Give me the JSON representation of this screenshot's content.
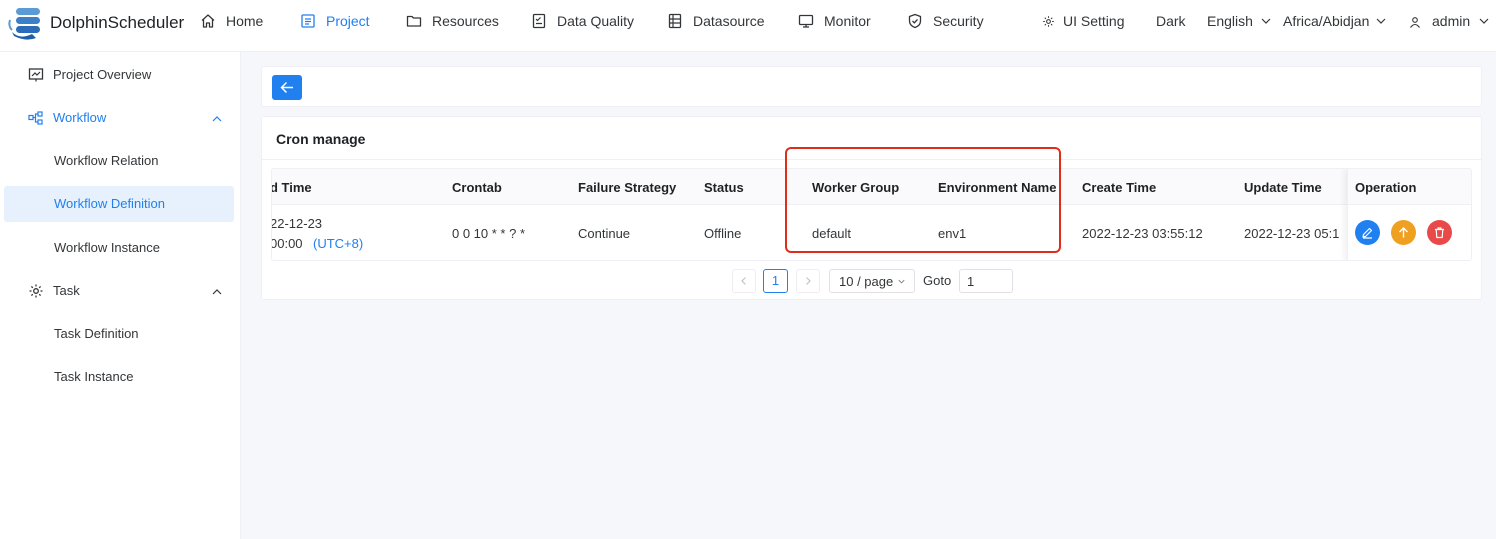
{
  "brand": {
    "name": "DolphinScheduler",
    "accent": "#2080f0"
  },
  "nav": {
    "home": "Home",
    "project": "Project",
    "resources": "Resources",
    "data_quality": "Data Quality",
    "datasource": "Datasource",
    "monitor": "Monitor",
    "security": "Security"
  },
  "header_right": {
    "ui_setting": "UI Setting",
    "theme": "Dark",
    "language": "English",
    "timezone": "Africa/Abidjan",
    "user": "admin"
  },
  "sidebar": {
    "project_overview": "Project Overview",
    "workflow": "Workflow",
    "workflow_relation": "Workflow Relation",
    "workflow_definition": "Workflow Definition",
    "workflow_instance": "Workflow Instance",
    "task": "Task",
    "task_definition": "Task Definition",
    "task_instance": "Task Instance"
  },
  "main": {
    "card_title": "Cron manage",
    "columns": {
      "end_time": "d Time",
      "crontab": "Crontab",
      "failure_strategy": "Failure Strategy",
      "status": "Status",
      "worker_group": "Worker Group",
      "environment_name": "Environment Name",
      "create_time": "Create Time",
      "update_time": "Update Time",
      "operation": "Operation"
    },
    "row": {
      "end_time_date": "22-12-23",
      "end_time_clock": "00:00",
      "end_time_tz": "(UTC+8)",
      "crontab": "0 0 10 * * ? *",
      "failure_strategy": "Continue",
      "status": "Offline",
      "worker_group": "default",
      "environment_name": "env1",
      "create_time": "2022-12-23 03:55:12",
      "update_time": "2022-12-23 05:1"
    },
    "pagination": {
      "current_page": "1",
      "page_size": "10 / page",
      "goto_label": "Goto",
      "goto_value": "1"
    }
  },
  "colors": {
    "edit": "#2080f0",
    "online": "#f0a020",
    "delete": "#d03050",
    "highlight": "#e02d1a"
  }
}
